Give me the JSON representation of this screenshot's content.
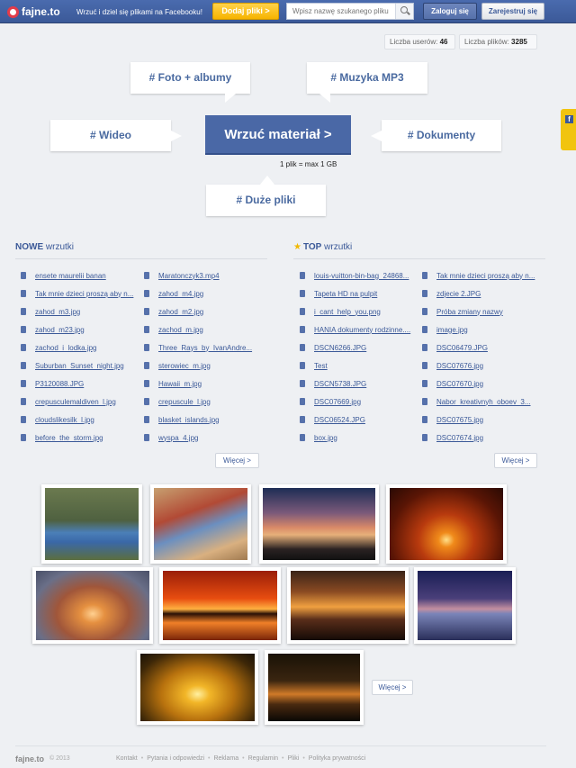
{
  "topbar": {
    "logo": "fajne.to",
    "tagline": "Wrzuć i dziel się plikami na Facebooku!",
    "add_button": "Dodaj pliki >",
    "search_placeholder": "Wpisz nazwę szukanego pliku",
    "login": "Zaloguj się",
    "register": "Zarejestruj się"
  },
  "stats": {
    "users_label": "Liczba userów:",
    "users_value": "46",
    "files_label": "Liczba plików:",
    "files_value": "3285"
  },
  "categories": {
    "photos": "# Foto + albumy",
    "music": "# Muzyka MP3",
    "video": "# Wideo",
    "documents": "# Dokumenty",
    "large": "# Duże pliki"
  },
  "upload": {
    "button": "Wrzuć materiał >",
    "limit": "1 plik = max 1 GB"
  },
  "new_section": {
    "title_bold": "NOWE",
    "title_rest": " wrzutki",
    "col1": [
      "ensete maurelii banan",
      "Tak mnie dzieci proszą aby n...",
      "zahod_m3.jpg",
      "zahod_m23.jpg",
      "zachod_i_lodka.jpg",
      "Suburban_Sunset_night.jpg",
      "P3120088.JPG",
      "crepusculemaldiven_l.jpg",
      "cloudslikesilk_l.jpg",
      "before_the_storm.jpg"
    ],
    "col2": [
      "Maratonczyk3.mp4",
      "zahod_m4.jpg",
      "zahod_m2.jpg",
      "zachod_m.jpg",
      "Three_Rays_by_IvanAndre...",
      "sterowiec_m.jpg",
      "Hawaii_m.jpg",
      "crepuscule_l.jpg",
      "blasket_islands.jpg",
      "wyspa_4.jpg"
    ],
    "more": "Więcej >"
  },
  "top_section": {
    "title_bold": "TOP",
    "title_rest": " wrzutki",
    "col1": [
      "louis-vuitton-bin-bag_24868...",
      "Tapeta HD na pulpit",
      "i_cant_help_you.png",
      "HANIA dokumenty rodzinne....",
      "DSCN6266.JPG",
      "Test",
      "DSCN5738.JPG",
      "DSC07669.jpg",
      "DSC06524.JPG",
      "box.jpg"
    ],
    "col2": [
      "Tak mnie dzieci proszą aby n...",
      "zdjecie 2.JPG",
      "Próba zmiany nazwy",
      "image.jpg",
      "DSC06479.JPG",
      "DSC07676.jpg",
      "DSC07670.jpg",
      "Nabor_kreativnyh_oboev_3...",
      "DSC07675.jpg",
      "DSC07674.jpg"
    ],
    "more": "Więcej >"
  },
  "gallery": {
    "more": "Więcej >",
    "photos": [
      "garden-statue-photo",
      "children-playing-photo",
      "sunset-clouds-photo",
      "orange-sunset-photo",
      "hazy-sunset-photo",
      "pier-sunset-photo",
      "dark-clouds-sunset-photo",
      "boat-dusk-photo",
      "golden-clouds-photo",
      "street-night-photo"
    ]
  },
  "footer": {
    "logo": "fajne.to",
    "copyright": "© 2013",
    "links": [
      "Kontakt",
      "Pytania i odpowiedzi",
      "Reklama",
      "Regulamin",
      "Pliki",
      "Polityka prywatności"
    ]
  }
}
